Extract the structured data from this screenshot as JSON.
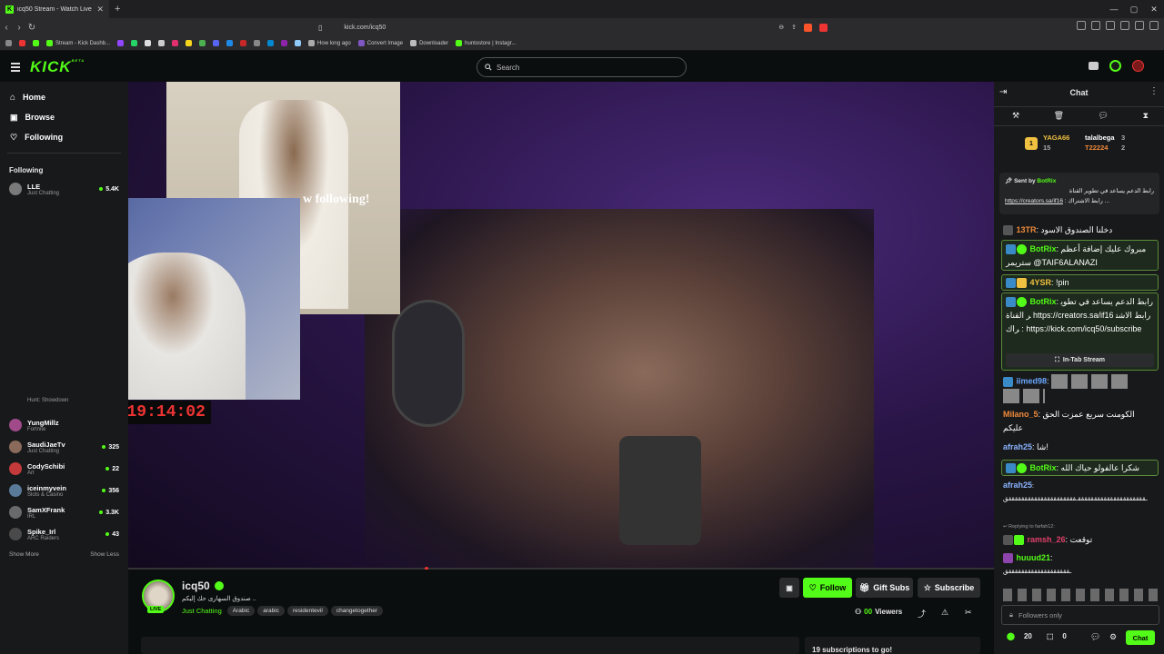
{
  "browser": {
    "tab_title": "icq50 Stream - Watch Live on Ki",
    "url": "kick.com/icq50",
    "bookmarks": [
      "Stream - Kick Dashb...",
      "How long ago",
      "Convert Image",
      "Downloader",
      "huntostore | Instagr..."
    ]
  },
  "header": {
    "logo": "KICK",
    "logo_sup": "BETA",
    "search_placeholder": "Search"
  },
  "sidebar": {
    "nav": [
      {
        "label": "Home",
        "icon": "home-icon"
      },
      {
        "label": "Browse",
        "icon": "browse-icon"
      },
      {
        "label": "Following",
        "icon": "heart-icon"
      }
    ],
    "following_heading": "Following",
    "channels": [
      {
        "name": "LLE",
        "category": "Just Chatting",
        "viewers": "5.4K"
      },
      {
        "name": "",
        "category": "Hunt: Showdown",
        "viewers": ""
      },
      {
        "name": "YungMillz",
        "category": "Fortnite",
        "viewers": ""
      },
      {
        "name": "SaudiJaeTv",
        "category": "Just Chatting",
        "viewers": "325"
      },
      {
        "name": "CodySchibi",
        "category": "Art",
        "viewers": "22"
      },
      {
        "name": "iceinmyvein",
        "category": "Slots & Casino",
        "viewers": "356"
      },
      {
        "name": "SamXFrank",
        "category": "IRL",
        "viewers": "3.3K"
      },
      {
        "name": "Spike_Irl",
        "category": "ARC Raiders",
        "viewers": "43"
      }
    ],
    "show_more": "Show More",
    "show_less": "Show Less"
  },
  "stream": {
    "overlay_text": "w following!",
    "timer": "00:19:14:02",
    "streamer": "icq50",
    "stream_title": "صندوق السهارى حك إليكم ..",
    "category": "Just Chatting",
    "tags": [
      "Arabic",
      "arabic",
      "residentevil",
      "changetogether"
    ],
    "live_label": "LIVE",
    "follow_label": "Follow",
    "gift_label": "Gift Subs",
    "subscribe_label": "Subscribe",
    "viewers": "00",
    "viewers_label": "Viewers",
    "sub_goal": "19 subscriptions to go!"
  },
  "chat": {
    "title": "Chat",
    "leaders": [
      {
        "name": "YAGA66",
        "value": "15"
      },
      {
        "name": "talalbega",
        "value": "3"
      },
      {
        "name": "T22224",
        "value": "2"
      }
    ],
    "pinned": {
      "sent_by": "Sent by",
      "author": "BotRix",
      "text": "رابط الدعم يساعد في تطوير القناة",
      "link": "https://creators.sa/if16",
      "suffix": ": رابط الاشتراك ..."
    },
    "messages": [
      {
        "user": "13TR",
        "text": "دخلنا الصندوق الاسود",
        "color": "#f08a3a"
      },
      {
        "user": "BotRix",
        "text": "مبروك عليك إضافة أعظم ستريمر @TAIF6ALANAZI",
        "color": "#53fc18",
        "bot": true
      },
      {
        "user": "4YSR",
        "text": "!pin",
        "color": "#f0c040"
      },
      {
        "user": "BotRix",
        "text": "رابط الدعم يساعد في تطوير القناة https://creators.sa/if16 رابط الاشتراك : https://kick.com/icq50/subscribe",
        "color": "#53fc18",
        "bot": true
      },
      {
        "user": "iimed98",
        "text": "",
        "color": "#6aa8ff"
      },
      {
        "user": "Milano_5",
        "text": "الكومنت سريع عمزت الحق عليكم",
        "color": "#f08a3a"
      },
      {
        "user": "afrah25",
        "text": "شا!",
        "color": "#8ab4ff"
      },
      {
        "user": "BotRix",
        "text": "شكرا عالفولو حياك الله",
        "color": "#53fc18",
        "bot": true
      },
      {
        "user": "afrah25",
        "text": "ـقققققققققققققققققققققـقققققققققققققققققققققق",
        "color": "#8ab4ff"
      },
      {
        "user": "ramsh_26",
        "text": "توقعت",
        "color": "#e0406a"
      },
      {
        "user": "huuud21",
        "text": "ـقققققققققققققققققققق",
        "color": "#53fc18"
      }
    ],
    "in_tab_stream": "In-Tab Stream",
    "reply_text": "Replying to farfah12:",
    "input_placeholder": "Followers only",
    "points": "20",
    "points2": "0",
    "chat_button": "Chat"
  }
}
